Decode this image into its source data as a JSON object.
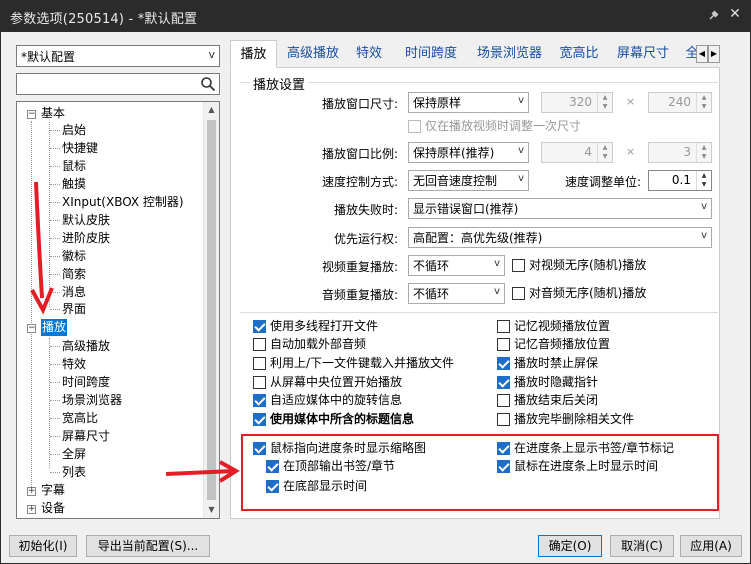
{
  "window": {
    "title": "参数选项(250514) - *默认配置"
  },
  "profile": {
    "selected": "*默认配置"
  },
  "search": {
    "value": ""
  },
  "tree": {
    "items": [
      "基本",
      "启始",
      "快捷键",
      "鼠标",
      "触摸",
      "XInput(XBOX 控制器)",
      "默认皮肤",
      "进阶皮肤",
      "徽标",
      "简索",
      "消息",
      "界面",
      "播放",
      "高级播放",
      "特效",
      "时间跨度",
      "场景浏览器",
      "宽高比",
      "屏幕尺寸",
      "全屏",
      "列表",
      "字幕",
      "设备"
    ],
    "selected": "播放"
  },
  "tabs": [
    "播放",
    "高级播放",
    "特效",
    "时间跨度",
    "场景浏览器",
    "宽高比",
    "屏幕尺寸",
    "全"
  ],
  "playback": {
    "group_title": "播放设置",
    "window_size_label": "播放窗口尺寸:",
    "window_size_value": "保持原样",
    "width": "320",
    "height": "240",
    "times": "×",
    "adjust_once": "仅在播放视频时调整一次尺寸",
    "ratio_label": "播放窗口比例:",
    "ratio_value": "保持原样(推荐)",
    "ratio_w": "4",
    "ratio_h": "3",
    "speed_mode_label": "速度控制方式:",
    "speed_mode_value": "无回音速度控制",
    "speed_unit_label": "速度调整单位:",
    "speed_unit_value": "0.1",
    "fail_label": "播放失败时:",
    "fail_value": "显示错误窗口(推荐)",
    "priority_label": "优先运行权:",
    "priority_value": "高配置：高优先级(推荐)",
    "video_repeat_label": "视频重复播放:",
    "video_repeat_value": "不循环",
    "video_shuffle": "对视频无序(随机)播放",
    "audio_repeat_label": "音频重复播放:",
    "audio_repeat_value": "不循环",
    "audio_shuffle": "对音频无序(随机)播放"
  },
  "options_left": [
    {
      "label": "使用多线程打开文件",
      "checked": true
    },
    {
      "label": "自动加载外部音频",
      "checked": false
    },
    {
      "label": "利用上/下一文件键载入并播放文件",
      "checked": false
    },
    {
      "label": "从屏幕中央位置开始播放",
      "checked": false
    },
    {
      "label": "自适应媒体中的旋转信息",
      "checked": true
    },
    {
      "label": "使用媒体中所含的标题信息",
      "checked": true
    },
    {
      "label": "鼠标指向进度条时显示缩略图",
      "checked": true
    },
    {
      "label": "在顶部输出书签/章节",
      "checked": true
    },
    {
      "label": "在底部显示时间",
      "checked": true
    }
  ],
  "options_right": [
    {
      "label": "记忆视频播放位置",
      "checked": false
    },
    {
      "label": "记忆音频播放位置",
      "checked": false
    },
    {
      "label": "播放时禁止屏保",
      "checked": true
    },
    {
      "label": "播放时隐藏指针",
      "checked": true
    },
    {
      "label": "播放结束后关闭",
      "checked": false
    },
    {
      "label": "播放完毕删除相关文件",
      "checked": false
    },
    {
      "label": "在进度条上显示书签/章节标记",
      "checked": true
    },
    {
      "label": "鼠标在进度条上时显示时间",
      "checked": true
    }
  ],
  "buttons": {
    "init": "初始化(I)",
    "export": "导出当前配置(S)...",
    "ok": "确定(O)",
    "cancel": "取消(C)",
    "apply": "应用(A)"
  },
  "colors": {
    "annotation": "#e41e26",
    "selection": "#0078d7",
    "checkbox": "#1e6ec8"
  }
}
